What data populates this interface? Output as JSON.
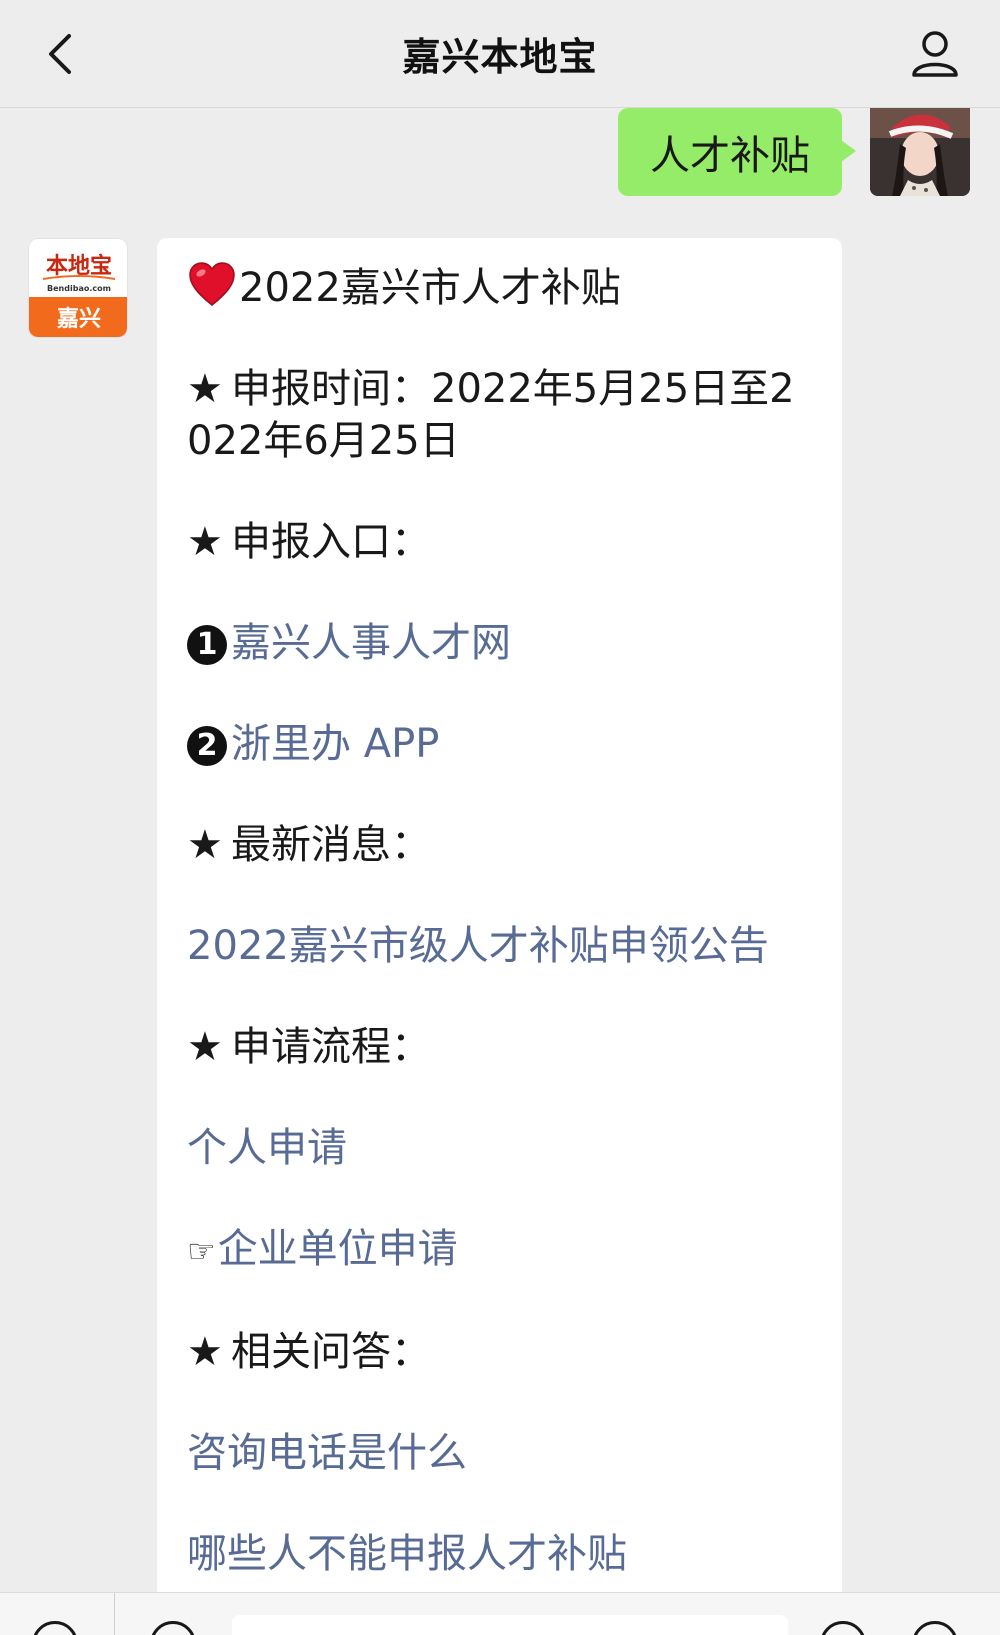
{
  "header": {
    "title": "嘉兴本地宝"
  },
  "user_message": {
    "text": "人才补贴"
  },
  "bot_avatar": {
    "brand_top": "本地宝",
    "brand_url": "Bendibao.com",
    "brand_city": "嘉兴"
  },
  "reply": {
    "title": "2022嘉兴市人才补贴",
    "apply_time_label": "申报时间：",
    "apply_time_value": "2022年5月25日至2022年6月25日",
    "entry_label": "申报入口：",
    "entry_1_num": "1",
    "entry_1_link": "嘉兴人事人才网",
    "entry_2_num": "2",
    "entry_2_link": "浙里办 APP",
    "news_label": "最新消息：",
    "news_link": "2022嘉兴市级人才补贴申领公告",
    "process_label": "申请流程：",
    "process_link_1": "个人申请",
    "process_link_2": "企业单位申请",
    "qa_label": "相关问答：",
    "qa_link_1": "咨询电话是什么",
    "qa_link_2": "哪些人不能申报人才补贴"
  },
  "colors": {
    "link": "#576b95",
    "self_bubble": "#95ec69",
    "brand_orange": "#f26b1d"
  },
  "icons": {
    "back": "chevron-left-icon",
    "profile": "person-icon",
    "heart": "heart-icon",
    "star": "star-icon",
    "hand": "pointing-hand-icon"
  }
}
